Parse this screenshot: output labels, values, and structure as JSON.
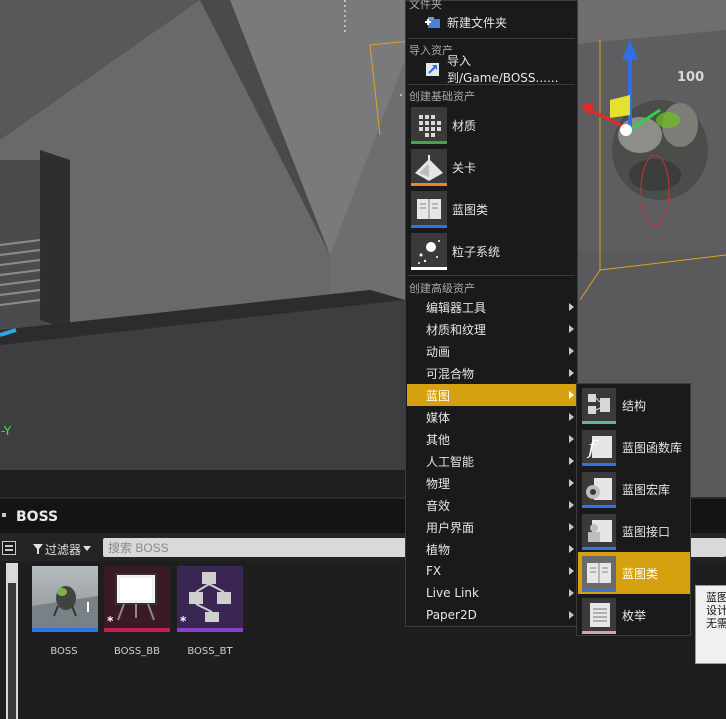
{
  "viewport": {
    "axis_y_label": "-Y",
    "lod_label": "100"
  },
  "content_browser": {
    "folder_title": "BOSS",
    "filter_label": "过滤器",
    "search_placeholder": "搜索 BOSS",
    "assets": [
      {
        "name": "BOSS",
        "bar_color": "#2f74e6"
      },
      {
        "name": "BOSS_BB",
        "bar_color": "#c02052"
      },
      {
        "name": "BOSS_BT",
        "bar_color": "#8a3fc9"
      }
    ]
  },
  "context_menu": {
    "folder_section": "文件夹",
    "new_folder": "新建文件夹",
    "import_section": "导入资产",
    "import_to": "导入到/Game/BOSS......",
    "basic_section": "创建基础资产",
    "basic_items": [
      {
        "label": "材质",
        "bar_color": "#3ca94a",
        "icon": "material-icon"
      },
      {
        "label": "关卡",
        "bar_color": "#e28a26",
        "icon": "level-icon"
      },
      {
        "label": "蓝图类",
        "bar_color": "#2f74e6",
        "icon": "blueprint-class-icon"
      },
      {
        "label": "粒子系统",
        "bar_color": "#ffffff",
        "icon": "particle-system-icon"
      }
    ],
    "advanced_section": "创建高级资产",
    "advanced_items": [
      {
        "label": "编辑器工具"
      },
      {
        "label": "材质和纹理"
      },
      {
        "label": "动画"
      },
      {
        "label": "可混合物"
      },
      {
        "label": "蓝图",
        "active": true
      },
      {
        "label": "媒体"
      },
      {
        "label": "其他"
      },
      {
        "label": "人工智能"
      },
      {
        "label": "物理"
      },
      {
        "label": "音效"
      },
      {
        "label": "用户界面"
      },
      {
        "label": "植物"
      },
      {
        "label": "FX"
      },
      {
        "label": "Live Link"
      },
      {
        "label": "Paper2D"
      }
    ]
  },
  "submenu": {
    "items": [
      {
        "label": "结构",
        "bar_color": "#5fb4a6",
        "icon": "structure-icon"
      },
      {
        "label": "蓝图函数库",
        "bar_color": "#2f74e6",
        "icon": "function-library-icon"
      },
      {
        "label": "蓝图宏库",
        "bar_color": "#2f74e6",
        "icon": "macro-library-icon"
      },
      {
        "label": "蓝图接口",
        "bar_color": "#2f74e6",
        "icon": "blueprint-interface-icon"
      },
      {
        "label": "蓝图类",
        "bar_color": "#2f74e6",
        "icon": "blueprint-class-icon",
        "active": true
      },
      {
        "label": "枚举",
        "bar_color": "#d9a0a8",
        "icon": "enum-icon"
      }
    ]
  },
  "tooltip": {
    "line1": "蓝图",
    "line2": "设计",
    "line3": "无需"
  }
}
